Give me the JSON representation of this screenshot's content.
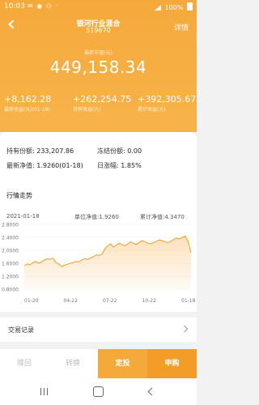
{
  "status_bar": {
    "time": "10:03",
    "battery": "100%",
    "icons": "✉ ◉ ⚇ ·"
  },
  "header": {
    "title": "银河行业混合",
    "code": "519670",
    "details_label": "详情",
    "latest_label": "最新市值(元)",
    "market_value": "449,158.34",
    "stats": [
      {
        "value": "+8,162.28",
        "label": "最新收益(元)(01-18)"
      },
      {
        "value": "+262,254.75",
        "label": "持有收益(元)"
      },
      {
        "value": "+392,305.67",
        "label": "累计收益(元)"
      }
    ]
  },
  "holdings": {
    "shares_label": "持有份额:",
    "shares_value": "233,207.86",
    "frozen_label": "冻结份额:",
    "frozen_value": "0.00",
    "nav_label": "最新净值:",
    "nav_value": "1.9260(01-18)",
    "change_label": "日涨幅:",
    "change_value": "1.85%"
  },
  "trend": {
    "title": "行情走势",
    "date": "2021-01-18",
    "unit_nav": "单位净值:1.9260",
    "acc_nav": "累计净值:4.3470"
  },
  "chart_data": {
    "type": "area",
    "y_ticks": [
      "2.8000",
      "2.4000",
      "2.0000",
      "1.6000",
      "1.2000",
      "0.8000"
    ],
    "ylim": [
      0.8,
      2.8
    ],
    "x_ticks": [
      "01-20",
      "04-22",
      "07-22",
      "10-22",
      "01-18"
    ],
    "series": [
      {
        "values": [
          1.52,
          1.58,
          1.55,
          1.62,
          1.66,
          1.6,
          1.64,
          1.7,
          1.74,
          1.72,
          1.76,
          1.62,
          1.58,
          1.5,
          1.54,
          1.57,
          1.6,
          1.62,
          1.66,
          1.64,
          1.7,
          1.74,
          1.72,
          1.76,
          1.8,
          1.86,
          1.84,
          1.88,
          2.04,
          2.14,
          2.2,
          2.1,
          2.16,
          2.22,
          2.18,
          2.14,
          2.2,
          2.26,
          2.22,
          2.18,
          2.24,
          2.3,
          2.26,
          2.22,
          2.2,
          2.24,
          2.28,
          2.32,
          2.3,
          2.26,
          2.24,
          2.28,
          2.34,
          2.38,
          2.35,
          2.4,
          2.44,
          2.28,
          1.93
        ]
      }
    ]
  },
  "records": {
    "label": "交易记录"
  },
  "actions": {
    "redeem": "赎回",
    "convert": "转换",
    "auto_invest": "定投",
    "purchase": "申购"
  }
}
